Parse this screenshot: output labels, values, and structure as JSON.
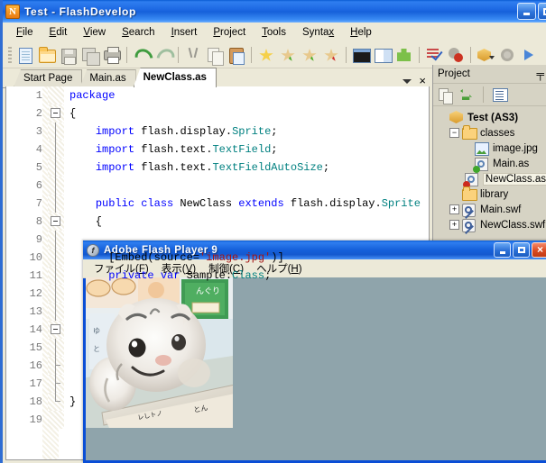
{
  "window": {
    "title": "Test - FlashDevelop",
    "icon": "flashdevelop-icon",
    "minimize_label": "Minimize",
    "maximize_label": "Maximize"
  },
  "menubar": {
    "items": [
      {
        "name": "file",
        "pre": "",
        "accel": "F",
        "post": "ile"
      },
      {
        "name": "edit",
        "pre": "",
        "accel": "E",
        "post": "dit"
      },
      {
        "name": "view",
        "pre": "",
        "accel": "V",
        "post": "iew"
      },
      {
        "name": "search",
        "pre": "",
        "accel": "S",
        "post": "earch"
      },
      {
        "name": "insert",
        "pre": "",
        "accel": "I",
        "post": "nsert"
      },
      {
        "name": "project",
        "pre": "",
        "accel": "P",
        "post": "roject"
      },
      {
        "name": "tools",
        "pre": "",
        "accel": "T",
        "post": "ools"
      },
      {
        "name": "syntax",
        "pre": "Synta",
        "accel": "x",
        "post": ""
      },
      {
        "name": "help",
        "pre": "",
        "accel": "H",
        "post": "elp"
      }
    ]
  },
  "toolbar": {
    "icons": [
      "new-file-icon",
      "open-folder-icon",
      "save-icon",
      "save-all-icon",
      "print-icon",
      "undo-icon",
      "redo-icon",
      "cut-icon",
      "copy-icon",
      "paste-icon",
      "bookmark-icon",
      "bookmark-next-icon",
      "bookmark-prev-icon",
      "bookmark-clear-icon",
      "console-icon",
      "panel-icon",
      "snippet-icon",
      "check-syntax-icon",
      "debug-icon",
      "build-package-icon",
      "settings-gear-icon",
      "run-icon"
    ]
  },
  "tabs": {
    "items": [
      {
        "label": "Start Page",
        "active": false
      },
      {
        "label": "Main.as",
        "active": false
      },
      {
        "label": "NewClass.as",
        "active": true
      }
    ],
    "dropdown_label": "Tab list",
    "close_label": "×"
  },
  "editor": {
    "lines": [
      {
        "num": "1",
        "fold": "none",
        "tokens": [
          {
            "t": "kw",
            "v": "package"
          }
        ]
      },
      {
        "num": "2",
        "fold": "minus",
        "tokens": [
          {
            "t": "p",
            "v": "{"
          }
        ]
      },
      {
        "num": "3",
        "fold": "line",
        "tokens": [
          {
            "t": "p",
            "v": "    "
          },
          {
            "t": "kw",
            "v": "import"
          },
          {
            "t": "p",
            "v": " flash.display."
          },
          {
            "t": "ty",
            "v": "Sprite"
          },
          {
            "t": "p",
            "v": ";"
          }
        ]
      },
      {
        "num": "4",
        "fold": "line",
        "tokens": [
          {
            "t": "p",
            "v": "    "
          },
          {
            "t": "kw",
            "v": "import"
          },
          {
            "t": "p",
            "v": " flash.text."
          },
          {
            "t": "ty",
            "v": "TextField"
          },
          {
            "t": "p",
            "v": ";"
          }
        ]
      },
      {
        "num": "5",
        "fold": "line",
        "tokens": [
          {
            "t": "p",
            "v": "    "
          },
          {
            "t": "kw",
            "v": "import"
          },
          {
            "t": "p",
            "v": " flash.text."
          },
          {
            "t": "ty",
            "v": "TextFieldAutoSize"
          },
          {
            "t": "p",
            "v": ";"
          }
        ]
      },
      {
        "num": "6",
        "fold": "line",
        "tokens": []
      },
      {
        "num": "7",
        "fold": "line",
        "tokens": [
          {
            "t": "p",
            "v": "    "
          },
          {
            "t": "kw",
            "v": "public class"
          },
          {
            "t": "p",
            "v": " NewClass "
          },
          {
            "t": "kw",
            "v": "extends"
          },
          {
            "t": "p",
            "v": " flash.display."
          },
          {
            "t": "ty",
            "v": "Sprite"
          }
        ]
      },
      {
        "num": "8",
        "fold": "minus2",
        "tokens": [
          {
            "t": "p",
            "v": "    {"
          }
        ]
      },
      {
        "num": "9",
        "fold": "line",
        "tokens": []
      },
      {
        "num": "10",
        "fold": "line",
        "tokens": [
          {
            "t": "p",
            "v": "      [Embed(source="
          },
          {
            "t": "str",
            "v": "'image.jpg'"
          },
          {
            "t": "p",
            "v": ")]"
          }
        ]
      },
      {
        "num": "11",
        "fold": "line",
        "tokens": [
          {
            "t": "p",
            "v": "      "
          },
          {
            "t": "kw",
            "v": "private var"
          },
          {
            "t": "p",
            "v": " Sample:"
          },
          {
            "t": "ty",
            "v": "Class"
          },
          {
            "t": "p",
            "v": ";"
          }
        ]
      },
      {
        "num": "12",
        "fold": "line",
        "tokens": []
      },
      {
        "num": "13",
        "fold": "line",
        "tokens": []
      },
      {
        "num": "14",
        "fold": "minus",
        "tokens": []
      },
      {
        "num": "15",
        "fold": "line",
        "tokens": []
      },
      {
        "num": "16",
        "fold": "tick",
        "tokens": []
      },
      {
        "num": "17",
        "fold": "tick",
        "tokens": []
      },
      {
        "num": "18",
        "fold": "end",
        "tokens": [
          {
            "t": "p",
            "v": "}"
          }
        ]
      },
      {
        "num": "19",
        "fold": "none",
        "tokens": []
      }
    ]
  },
  "project_panel": {
    "title": "Project",
    "pin_glyph": "╤",
    "toolbar_icons": [
      "copy-icon",
      "synchronize-icon",
      "options-list-icon"
    ],
    "tree": [
      {
        "depth": 0,
        "expander": "none",
        "icon": "project-package-icon",
        "label": "Test (AS3)",
        "bold": true,
        "selected": false
      },
      {
        "depth": 1,
        "expander": "minus",
        "icon": "folder-icon",
        "label": "classes",
        "bold": false,
        "selected": false
      },
      {
        "depth": 2,
        "expander": "none",
        "icon": "image-file-icon",
        "label": "image.jpg",
        "bold": false,
        "selected": false
      },
      {
        "depth": 2,
        "expander": "none",
        "icon": "as-file-green-icon",
        "label": "Main.as",
        "bold": false,
        "selected": false
      },
      {
        "depth": 2,
        "expander": "none",
        "icon": "as-file-red-icon",
        "label": "NewClass.as",
        "bold": false,
        "selected": true
      },
      {
        "depth": 1,
        "expander": "none",
        "icon": "folder-icon",
        "label": "library",
        "bold": false,
        "selected": false
      },
      {
        "depth": 1,
        "expander": "plus",
        "icon": "swf-file-icon",
        "label": "Main.swf",
        "bold": false,
        "selected": false
      },
      {
        "depth": 1,
        "expander": "plus",
        "icon": "swf-file-icon",
        "label": "NewClass.swf",
        "bold": false,
        "selected": false
      }
    ]
  },
  "flash_player": {
    "title": "Adobe Flash Player 9",
    "icon": "flash-player-icon",
    "minimize_label": "Minimize",
    "maximize_label": "Maximize",
    "close_label": "×",
    "menu": [
      {
        "name": "file",
        "pre": "ファイル(",
        "accel": "F",
        "post": ")"
      },
      {
        "name": "view",
        "pre": "表示(",
        "accel": "V",
        "post": ")"
      },
      {
        "name": "control",
        "pre": "制御(",
        "accel": "C",
        "post": ")"
      },
      {
        "name": "help",
        "pre": "ヘルプ(",
        "accel": "H",
        "post": ")"
      }
    ],
    "stage_bg": "#8fa4ab",
    "content_alt": "Photo of a white tiger plush toy"
  },
  "colors": {
    "titlebar_blue": "#1560da",
    "keyword_blue": "#0000ff",
    "type_teal": "#008080",
    "string_red": "#a31515",
    "panel_bg": "#d6d3c4",
    "chrome_bg": "#ece9d8",
    "stage_gray": "#8fa4ab"
  }
}
